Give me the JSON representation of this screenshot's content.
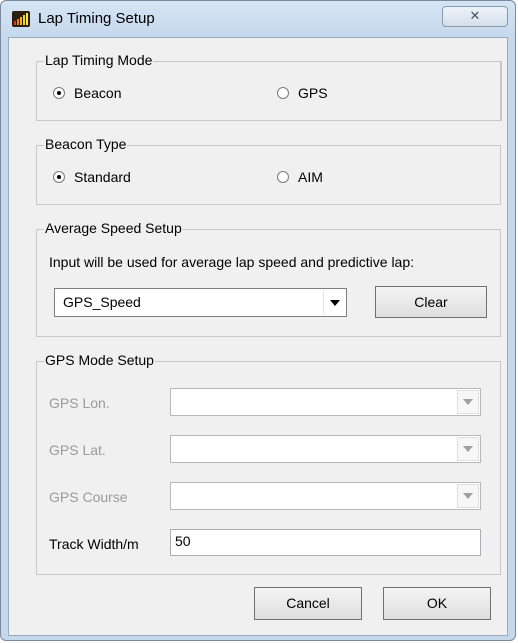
{
  "window": {
    "title": "Lap Timing Setup",
    "close_glyph": "✕"
  },
  "lap_timing_mode": {
    "title": "Lap Timing Mode",
    "options": [
      {
        "label": "Beacon",
        "selected": true
      },
      {
        "label": "GPS",
        "selected": false
      }
    ]
  },
  "beacon_type": {
    "title": "Beacon Type",
    "options": [
      {
        "label": "Standard",
        "selected": true
      },
      {
        "label": "AIM",
        "selected": false
      }
    ]
  },
  "average_speed": {
    "title": "Average Speed Setup",
    "description": "Input will be used for average lap speed and predictive lap:",
    "selected": "GPS_Speed",
    "clear_label": "Clear"
  },
  "gps_mode": {
    "title": "GPS Mode Setup",
    "lon_label": "GPS Lon.",
    "lon_value": "",
    "lat_label": "GPS Lat.",
    "lat_value": "",
    "course_label": "GPS Course",
    "course_value": "",
    "track_width_label": "Track Width/m",
    "track_width_value": "50"
  },
  "footer": {
    "cancel_label": "Cancel",
    "ok_label": "OK"
  }
}
